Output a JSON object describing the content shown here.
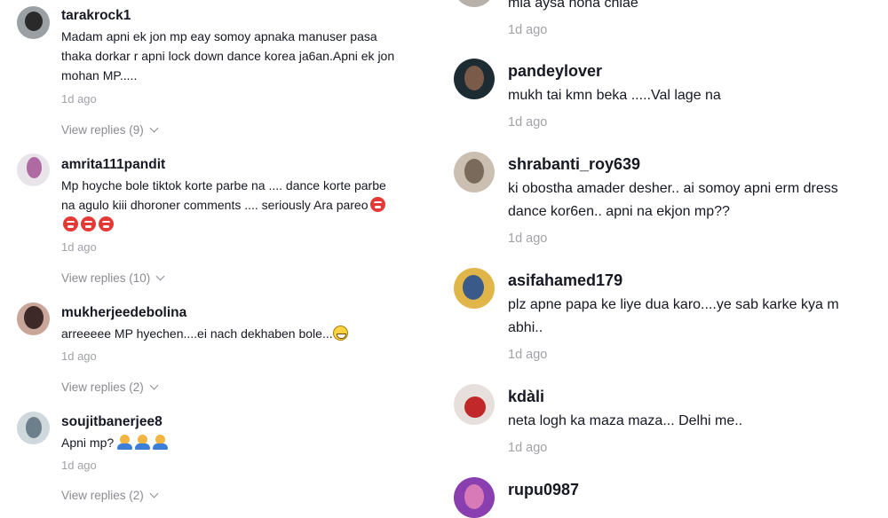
{
  "left_comments": [
    {
      "username": "tarakrock1",
      "lines": [
        "Madam apni ek jon mp eay somoy apnaka manuser pasa",
        "thaka dorkar r apni lock down dance korea ja6an.Apni ek jon",
        "mohan MP....."
      ],
      "time": "1d ago",
      "replies": "View replies (9)",
      "avatar_colors": [
        "#9aa0a3",
        "#2a2a2a"
      ]
    },
    {
      "username": "amrita111pandit",
      "lines": [
        "Mp hoyche bole tiktok korte parbe na .... dance korte parbe",
        "na agulo kiii dhoroner comments .... seriously Ara pareo",
        ""
      ],
      "time": "1d ago",
      "replies": "View replies (10)",
      "avatar_colors": [
        "#e9e4ea",
        "#b06aa3"
      ]
    },
    {
      "username": "mukherjeedebolina",
      "lines": [
        "arreeeee MP hyechen....ei nach dekhaben bole..."
      ],
      "time": "1d ago",
      "replies": "View replies (2)",
      "avatar_colors": [
        "#c9a59a",
        "#3d2a28"
      ]
    },
    {
      "username": "soujitbanerjee8",
      "lines": [
        "Apni mp? "
      ],
      "time": "1d ago",
      "replies": "View replies (2)",
      "avatar_colors": [
        "#cfd8dc",
        "#6d7f8a"
      ]
    }
  ],
  "right_comments": [
    {
      "username": "",
      "lines": [
        "mia aysa hona chiae"
      ],
      "time": "1d ago",
      "avatar_colors": [
        "#b7b1aa",
        "#5a534d"
      ]
    },
    {
      "username": "pandeylover",
      "lines": [
        "mukh tai kmn beka .....Val lage na"
      ],
      "time": "1d ago",
      "avatar_colors": [
        "#1d2b33",
        "#7a5a48"
      ]
    },
    {
      "username": "shrabanti_roy639",
      "lines": [
        "ki obostha amader desher.. ai somoy apni erm dress",
        "dance kor6en.. apni na ekjon mp??"
      ],
      "time": "1d ago",
      "avatar_colors": [
        "#cbbfb2",
        "#7a6a5c"
      ]
    },
    {
      "username": "asifahamed179",
      "lines": [
        "plz apne papa ke liye dua karo....ye sab karke kya m",
        "abhi.."
      ],
      "time": "1d ago",
      "avatar_colors": [
        "#e0b54a",
        "#3a5a8a"
      ]
    },
    {
      "username": "kdàli",
      "lines": [
        "neta logh ka maza maza... Delhi me.."
      ],
      "time": "1d ago",
      "avatar_colors": [
        "#e7dfdc",
        "#c0282a"
      ]
    },
    {
      "username": "rupu0987",
      "lines": [],
      "time": "",
      "avatar_colors": [
        "#8a3fb0",
        "#d87ab8"
      ]
    }
  ]
}
